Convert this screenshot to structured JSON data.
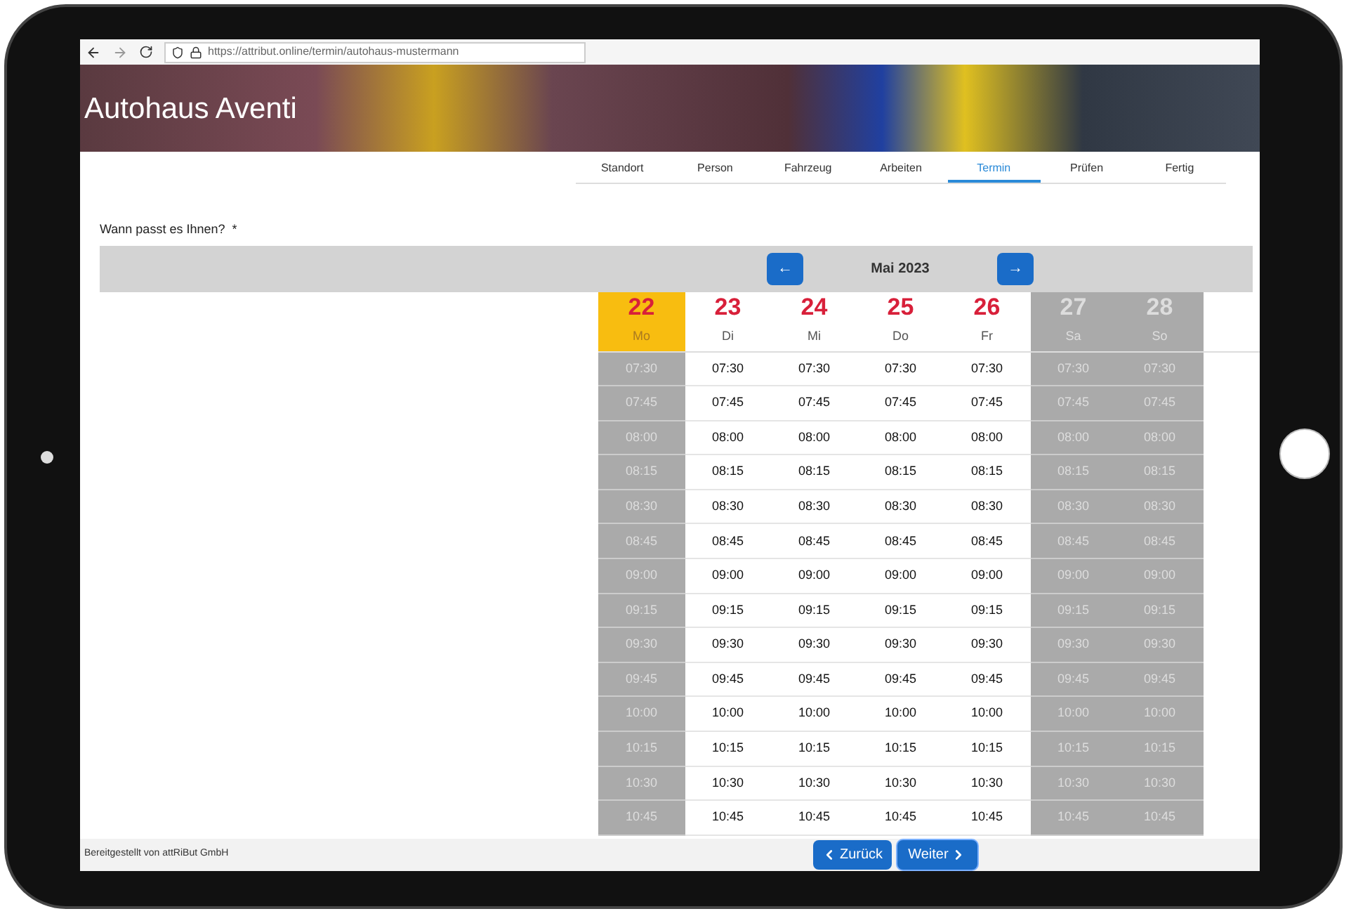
{
  "browser": {
    "url": "https://attribut.online/termin/autohaus-mustermann"
  },
  "header": {
    "title": "Autohaus Aventi"
  },
  "steps": [
    {
      "label": "Standort",
      "selected": false
    },
    {
      "label": "Person",
      "selected": false
    },
    {
      "label": "Fahrzeug",
      "selected": false
    },
    {
      "label": "Arbeiten",
      "selected": false
    },
    {
      "label": "Termin",
      "selected": true
    },
    {
      "label": "Prüfen",
      "selected": false
    },
    {
      "label": "Fertig",
      "selected": false
    }
  ],
  "question": "Wann passt es Ihnen?  *",
  "calendar": {
    "prev_icon": "←",
    "month": "Mai 2023",
    "next_icon": "→",
    "days": [
      {
        "date": "22",
        "weekday": "Mo",
        "selected": true,
        "available": false,
        "slots": [
          "07:30",
          "07:45",
          "08:00",
          "08:15",
          "08:30",
          "08:45",
          "09:00",
          "09:15",
          "09:30",
          "09:45",
          "10:00",
          "10:15",
          "10:30",
          "10:45"
        ]
      },
      {
        "date": "23",
        "weekday": "Di",
        "selected": false,
        "available": true,
        "slots": [
          "07:30",
          "07:45",
          "08:00",
          "08:15",
          "08:30",
          "08:45",
          "09:00",
          "09:15",
          "09:30",
          "09:45",
          "10:00",
          "10:15",
          "10:30",
          "10:45"
        ]
      },
      {
        "date": "24",
        "weekday": "Mi",
        "selected": false,
        "available": true,
        "slots": [
          "07:30",
          "07:45",
          "08:00",
          "08:15",
          "08:30",
          "08:45",
          "09:00",
          "09:15",
          "09:30",
          "09:45",
          "10:00",
          "10:15",
          "10:30",
          "10:45"
        ]
      },
      {
        "date": "25",
        "weekday": "Do",
        "selected": false,
        "available": true,
        "slots": [
          "07:30",
          "07:45",
          "08:00",
          "08:15",
          "08:30",
          "08:45",
          "09:00",
          "09:15",
          "09:30",
          "09:45",
          "10:00",
          "10:15",
          "10:30",
          "10:45"
        ]
      },
      {
        "date": "26",
        "weekday": "Fr",
        "selected": false,
        "available": true,
        "slots": [
          "07:30",
          "07:45",
          "08:00",
          "08:15",
          "08:30",
          "08:45",
          "09:00",
          "09:15",
          "09:30",
          "09:45",
          "10:00",
          "10:15",
          "10:30",
          "10:45"
        ]
      },
      {
        "date": "27",
        "weekday": "Sa",
        "selected": false,
        "available": false,
        "slots": [
          "07:30",
          "07:45",
          "08:00",
          "08:15",
          "08:30",
          "08:45",
          "09:00",
          "09:15",
          "09:30",
          "09:45",
          "10:00",
          "10:15",
          "10:30",
          "10:45"
        ]
      },
      {
        "date": "28",
        "weekday": "So",
        "selected": false,
        "available": false,
        "slots": [
          "07:30",
          "07:45",
          "08:00",
          "08:15",
          "08:30",
          "08:45",
          "09:00",
          "09:15",
          "09:30",
          "09:45",
          "10:00",
          "10:15",
          "10:30",
          "10:45"
        ]
      }
    ]
  },
  "footer": {
    "credit": "Bereitgestellt von attRiBut GmbH",
    "back": "Zurück",
    "next": "Weiter"
  }
}
